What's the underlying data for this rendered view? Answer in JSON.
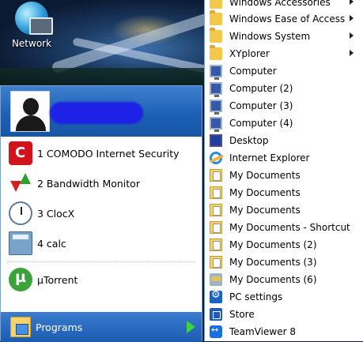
{
  "desktop": {
    "icon_label": "Network"
  },
  "start_left": {
    "apps": [
      {
        "label": "1 COMODO Internet Security",
        "icon": "comodo-icon"
      },
      {
        "label": "2 Bandwidth Monitor",
        "icon": "bandwidth-monitor-icon"
      },
      {
        "label": "3 ClocX",
        "icon": "clock-icon"
      },
      {
        "label": "4 calc",
        "icon": "calculator-icon"
      },
      {
        "label": "µTorrent",
        "icon": "utorrent-icon"
      }
    ],
    "programs_label": "Programs"
  },
  "all_programs": [
    {
      "label": "Windows Accessories",
      "icon": "folder-icon",
      "submenu": true
    },
    {
      "label": "Windows Ease of Access",
      "icon": "folder-icon",
      "submenu": true
    },
    {
      "label": "Windows System",
      "icon": "folder-icon",
      "submenu": true
    },
    {
      "label": "XYplorer",
      "icon": "folder-icon",
      "submenu": true
    },
    {
      "label": "Computer",
      "icon": "computer-icon",
      "submenu": false
    },
    {
      "label": "Computer (2)",
      "icon": "computer-icon",
      "submenu": false
    },
    {
      "label": "Computer (3)",
      "icon": "computer-icon",
      "submenu": false
    },
    {
      "label": "Computer (4)",
      "icon": "computer-icon",
      "submenu": false
    },
    {
      "label": "Desktop",
      "icon": "desktop-icon",
      "submenu": false
    },
    {
      "label": "Internet Explorer",
      "icon": "internet-explorer-icon",
      "submenu": false
    },
    {
      "label": "My Documents",
      "icon": "documents-folder-icon",
      "submenu": false
    },
    {
      "label": "My Documents",
      "icon": "documents-folder-icon",
      "submenu": false
    },
    {
      "label": "My Documents",
      "icon": "documents-folder-icon",
      "submenu": false
    },
    {
      "label": "My Documents - Shortcut",
      "icon": "documents-folder-icon",
      "submenu": false
    },
    {
      "label": "My Documents (2)",
      "icon": "documents-folder-icon",
      "submenu": false
    },
    {
      "label": "My Documents (3)",
      "icon": "documents-folder-icon",
      "submenu": false
    },
    {
      "label": "My Documents (6)",
      "icon": "network-folder-icon",
      "submenu": false
    },
    {
      "label": "PC settings",
      "icon": "gear-icon",
      "submenu": false
    },
    {
      "label": "Store",
      "icon": "store-icon",
      "submenu": false
    },
    {
      "label": "TeamViewer 8",
      "icon": "teamviewer-icon",
      "submenu": false
    }
  ],
  "colors": {
    "header_blue": "#1b5fb3",
    "programs_bar": "#1c5cb0",
    "programs_arrow": "#3ed13e",
    "name_redaction": "#1e21e6"
  }
}
